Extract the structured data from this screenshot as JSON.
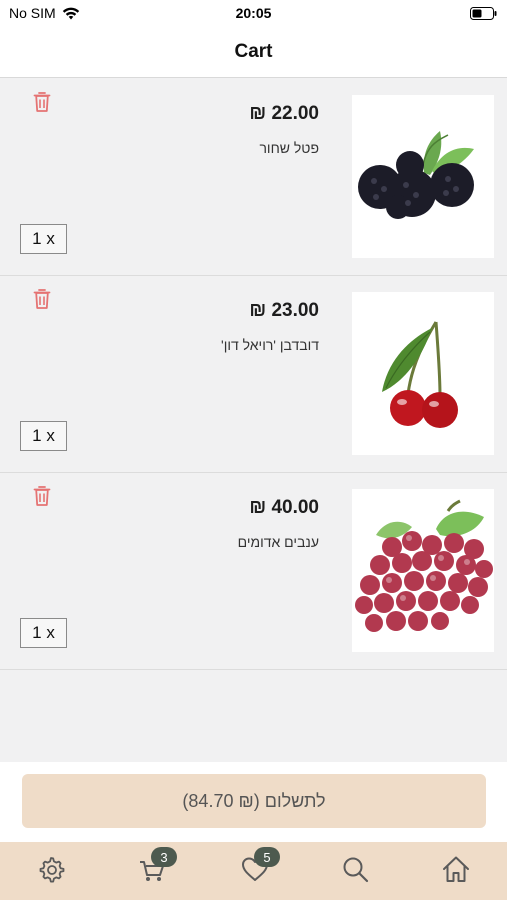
{
  "status_bar": {
    "carrier": "No SIM",
    "time": "20:05"
  },
  "nav": {
    "title": "Cart"
  },
  "cart": {
    "items": [
      {
        "price": "₪ 22.00",
        "name": "פטל שחור",
        "quantity": "1 x",
        "image_icon": "blackberries-image"
      },
      {
        "price": "₪ 23.00",
        "name": "דובדבן 'רויאל דון'",
        "quantity": "1 x",
        "image_icon": "cherries-image"
      },
      {
        "price": "₪ 40.00",
        "name": "ענבים אדומים",
        "quantity": "1 x",
        "image_icon": "red-grapes-image"
      }
    ]
  },
  "checkout": {
    "label": "לתשלום (₪ 84.70)"
  },
  "tab_bar": {
    "tabs": [
      {
        "icon": "gear-icon"
      },
      {
        "icon": "cart-icon",
        "badge": "3"
      },
      {
        "icon": "heart-icon",
        "badge": "5"
      },
      {
        "icon": "search-icon"
      },
      {
        "icon": "home-icon"
      }
    ]
  },
  "colors": {
    "accent": "#efdcc8",
    "trash": "#e57373",
    "badge": "#4d5a4f",
    "list_background": "#f1f1f2"
  }
}
